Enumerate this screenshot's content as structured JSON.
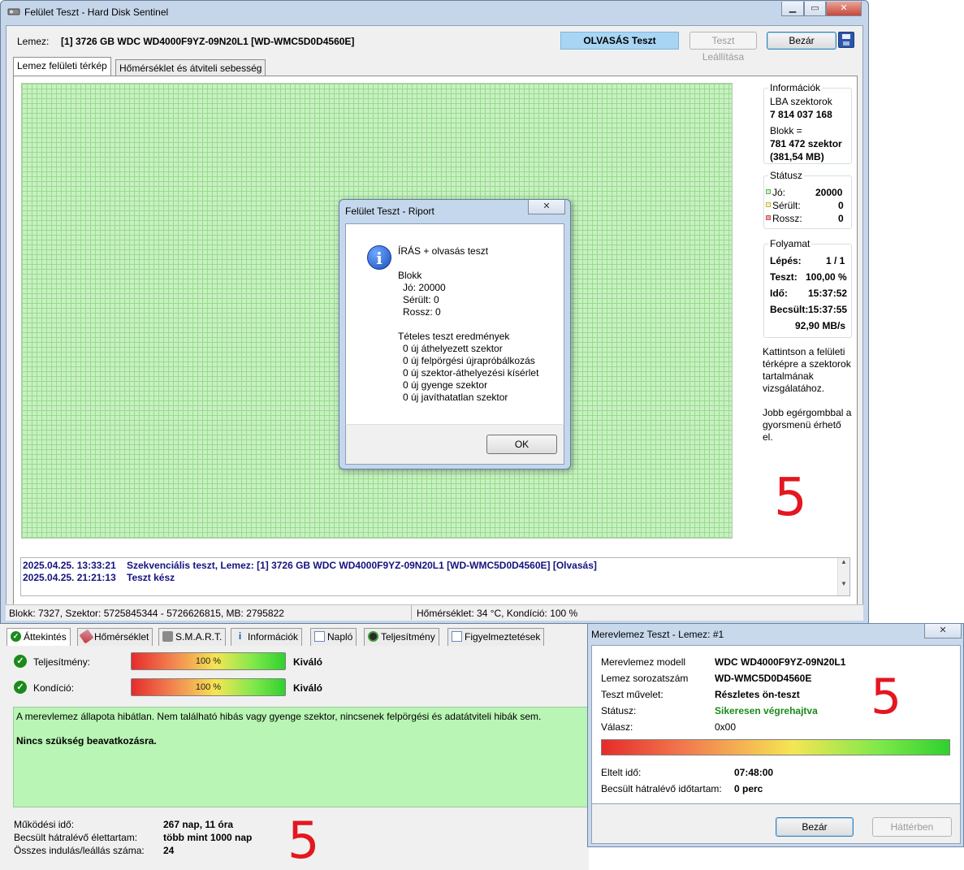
{
  "main_window": {
    "title": "Felület Teszt - Hard Disk Sentinel",
    "disk_label": "Lemez:",
    "disk_value": "[1] 3726 GB  WDC WD4000F9YZ-09N20L1 [WD-WMC5D0D4560E]",
    "status_button": "OLVASÁS Teszt",
    "stop_button": "Teszt Leállítása",
    "close_button": "Bezár",
    "tabs": [
      "Lemez felületi térkép",
      "Hőmérséklet és átviteli sebesség"
    ],
    "info_group": {
      "title": "Információk",
      "lba_label": "LBA szektorok",
      "lba_value": "7 814 037 168",
      "block_label": "Blokk =",
      "block_value": "781 472 szektor",
      "block_size": "(381,54 MB)"
    },
    "status_group": {
      "title": "Státusz",
      "good_label": "Jó:",
      "good_value": "20000",
      "damaged_label": "Sérült:",
      "damaged_value": "0",
      "bad_label": "Rossz:",
      "bad_value": "0"
    },
    "progress_group": {
      "title": "Folyamat",
      "step_label": "Lépés:",
      "step_value": "1 / 1",
      "test_label": "Teszt:",
      "test_value": "100,00 %",
      "time_label": "Idő:",
      "time_value": "15:37:52",
      "est_label": "Becsült:",
      "est_value": "15:37:55",
      "speed": "92,90 MB/s"
    },
    "hint1": "Kattintson a felületi térképre a szektorok tartalmának vizsgálatához.",
    "hint2": "Jobb egérgombbal a gyorsmenü érhető el.",
    "annotation": "5",
    "log": [
      {
        "date": "2025.04.25.  13:33:21",
        "text": "Szekvenciális teszt, Lemez: [1] 3726 GB  WDC WD4000F9YZ-09N20L1 [WD-WMC5D0D4560E] [Olvasás]"
      },
      {
        "date": "2025.04.25.  21:21:13",
        "text": "Teszt kész"
      }
    ],
    "statusbar_left": "Blokk: 7327, Szektor: 5725845344 - 5726626815, MB: 2795822",
    "statusbar_right": "Hőmérséklet: 34  °C,  Kondíció: 100 %"
  },
  "report_dialog": {
    "title": "Felület Teszt - Riport",
    "heading": "ÍRÁS + olvasás teszt",
    "block_title": "Blokk",
    "good": "Jó: 20000",
    "damaged": "Sérült: 0",
    "bad": "Rossz: 0",
    "results_title": "Tételes teszt eredmények",
    "results": [
      "0 új áthelyezett szektor",
      "0 új felpörgési újrapróbálkozás",
      "0 új szektor-áthelyezési kísérlet",
      "0 új gyenge szektor",
      "0 új javíthatatlan szektor"
    ],
    "ok_button": "OK"
  },
  "overview_panel": {
    "tabs": [
      "Áttekintés",
      "Hőmérséklet",
      "S.M.A.R.T.",
      "Információk",
      "Napló",
      "Teljesítmény",
      "Figyelmeztetések"
    ],
    "performance_label": "Teljesítmény:",
    "performance_value": "100 %",
    "performance_percent": 100,
    "performance_rating": "Kiváló",
    "condition_label": "Kondíció:",
    "condition_value": "100 %",
    "condition_percent": 100,
    "condition_rating": "Kiváló",
    "message": "A merevlemez állapota hibátlan. Nem található hibás vagy gyenge szektor, nincsenek felpörgési és adatátviteli hibák sem.",
    "message_bold": "Nincs szükség beavatkozásra.",
    "uptime_label": "Működési idő:",
    "uptime_value": "267 nap, 11 óra",
    "life_label": "Becsült hátralévő élettartam:",
    "life_value": "több mint 1000 nap",
    "starts_label": "Összes indulás/leállás száma:",
    "starts_value": "24",
    "annotation": "5"
  },
  "selftest_window": {
    "title": "Merevlemez Teszt - Lemez: #1",
    "model_label": "Merevlemez modell",
    "model_value": "WDC WD4000F9YZ-09N20L1",
    "serial_label": "Lemez sorozatszám",
    "serial_value": "WD-WMC5D0D4560E",
    "op_label": "Teszt művelet:",
    "op_value": "Részletes ön-teszt",
    "status_label": "Státusz:",
    "status_value": "Sikeresen végrehajtva",
    "response_label": "Válasz:",
    "response_value": "0x00",
    "elapsed_label": "Eltelt idő:",
    "elapsed_value": "07:48:00",
    "remaining_label": "Becsült hátralévő időtartam:",
    "remaining_value": "0 perc",
    "close_button": "Bezár",
    "background_button": "Háttérben",
    "annotation": "5"
  },
  "colors": {
    "good_green": "#c9f0c3",
    "status_button_bg": "#a9d5f5",
    "log_text": "#14127f",
    "success_green": "#1a8a1a",
    "message_bg": "#b9f5b4",
    "annotation_red": "#e4161f"
  }
}
